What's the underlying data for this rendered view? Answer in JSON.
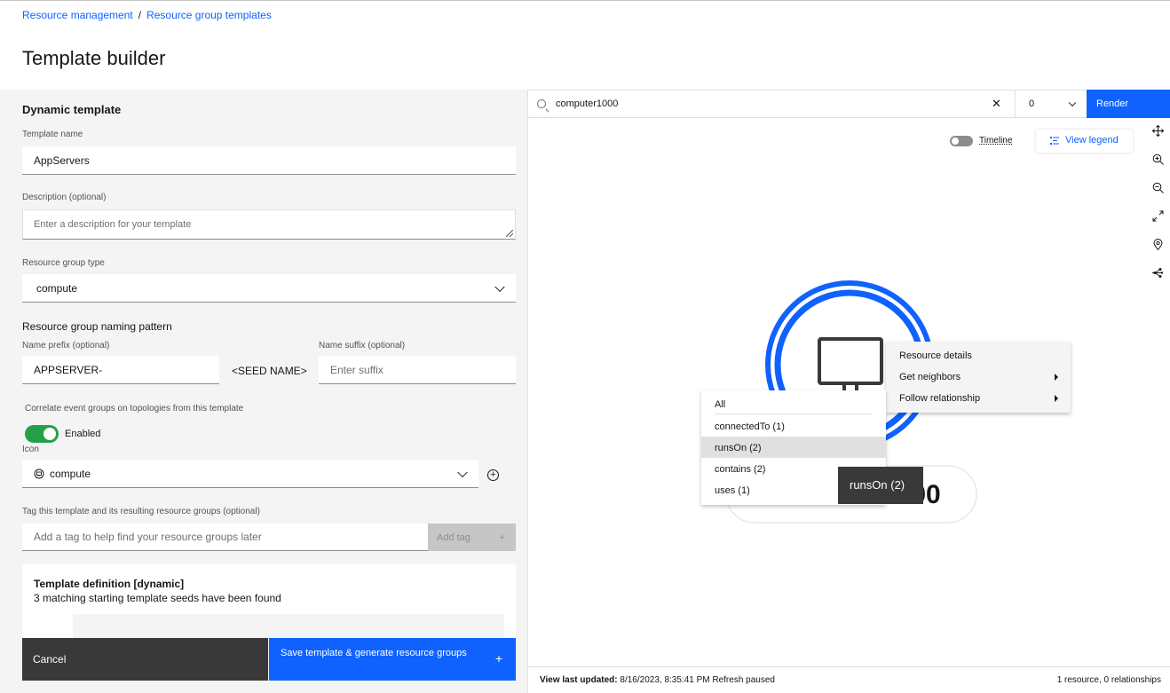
{
  "breadcrumb": {
    "items": [
      "Resource management",
      "Resource group templates"
    ],
    "separator": "/"
  },
  "page": {
    "title": "Template builder"
  },
  "form": {
    "section_title": "Dynamic template",
    "template_name": {
      "label": "Template name",
      "value": "AppServers"
    },
    "description": {
      "label": "Description (optional)",
      "placeholder": "Enter a description for your template"
    },
    "resource_group_type": {
      "label": "Resource group type",
      "value": "compute"
    },
    "naming": {
      "heading": "Resource group naming pattern",
      "prefix_label": "Name prefix (optional)",
      "prefix_value": "APPSERVER-",
      "seed": "<SEED NAME>",
      "suffix_label": "Name suffix (optional)",
      "suffix_placeholder": "Enter suffix"
    },
    "correlate": {
      "label": "Correlate event groups on topologies from this template",
      "toggle_label": "Enabled",
      "enabled": true
    },
    "icon": {
      "label": "Icon",
      "value": "compute",
      "icon_name": "compute-icon"
    },
    "tags": {
      "label": "Tag this template and its resulting resource groups (optional)",
      "placeholder": "Add a tag to help find your resource groups later",
      "button": "Add tag",
      "button_icon": "+"
    },
    "definition": {
      "title": "Template definition [dynamic]",
      "subtitle": "3 matching starting template seeds have been found"
    },
    "cancel_label": "Cancel",
    "save_label": "Save template & generate resource groups",
    "save_icon": "+"
  },
  "topology": {
    "search_value": "computer1000",
    "clear_icon": "✕",
    "depth_value": "0",
    "render_label": "Render",
    "timeline_label": "Timeline",
    "legend_label": "View legend",
    "node_label": "1000",
    "node_prefix": "r",
    "context_menu": [
      {
        "label": "Resource details",
        "has_submenu": false
      },
      {
        "label": "Get neighbors",
        "has_submenu": true
      },
      {
        "label": "Follow relationship",
        "has_submenu": true
      }
    ],
    "submenu": [
      {
        "label": "All"
      },
      {
        "label": "connectedTo (1)"
      },
      {
        "label": "runsOn (2)",
        "active": true
      },
      {
        "label": "contains (2)"
      },
      {
        "label": "uses (1)"
      }
    ],
    "tooltip": "runsOn (2)",
    "status": {
      "updated_label": "View last updated:",
      "updated_value": "8/16/2023, 8:35:41 PM Refresh paused",
      "summary": "1 resource, 0 relationships"
    },
    "tools": [
      "move-icon",
      "zoom-in-icon",
      "zoom-out-icon",
      "fit-to-screen-icon",
      "location-icon",
      "layout-icon"
    ]
  },
  "colors": {
    "primary": "#0f62fe",
    "toggle_on": "#24a148",
    "dark_button": "#393939"
  }
}
